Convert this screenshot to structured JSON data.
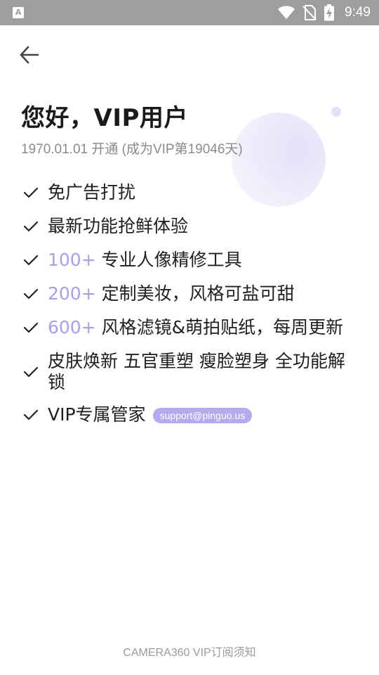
{
  "status_bar": {
    "app_icon": "A",
    "time": "9:49",
    "icons": [
      "wifi-icon",
      "no-sim-icon",
      "battery-charging-icon"
    ]
  },
  "header": {
    "back_icon": "arrow-left-icon"
  },
  "greeting": "您好，VIP用户",
  "subtitle": "1970.01.01 开通 (成为VIP第19046天)",
  "benefits": [
    {
      "prefix": "",
      "text": "免广告打扰"
    },
    {
      "prefix": "",
      "text": "最新功能抢鲜体验"
    },
    {
      "prefix": "100+",
      "text": " 专业人像精修工具"
    },
    {
      "prefix": "200+",
      "text": " 定制美妆，风格可盐可甜"
    },
    {
      "prefix": "600+",
      "text": " 风格滤镜&萌拍贴纸，每周更新"
    },
    {
      "prefix": "",
      "text": "皮肤焕新 五官重塑 瘦脸塑身 全功能解锁"
    },
    {
      "prefix": "",
      "text": "VIP专属管家",
      "badge": "support@pinguo.us"
    }
  ],
  "footer_link": "CAMERA360 VIP订阅须知",
  "colors": {
    "accent": "#a79ef0",
    "badge_bg": "#b5a9ef",
    "status_bar": "#9e9e9e",
    "subtitle": "#8a8a8a"
  }
}
